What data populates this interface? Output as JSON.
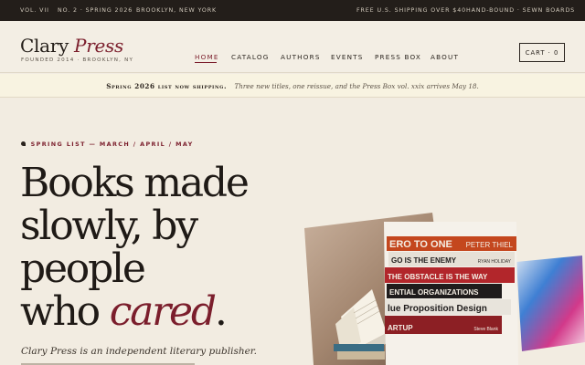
{
  "topbar": {
    "volume": "VOL. VII",
    "issue": "NO. 2 · SPRING 2026",
    "location": "BROOKLYN, NEW YORK",
    "shipping": "FREE U.S. SHIPPING OVER $40",
    "binding": "HAND-BOUND · SEWN BOARDS"
  },
  "brand": {
    "name": "Clary",
    "name_accent": "Press",
    "tagline": "FOUNDED 2014 · BROOKLYN, NY"
  },
  "nav": {
    "items": [
      {
        "label": "HOME",
        "active": true
      },
      {
        "label": "CATALOG"
      },
      {
        "label": "AUTHORS"
      },
      {
        "label": "EVENTS"
      },
      {
        "label": "PRESS BOX"
      },
      {
        "label": "ABOUT"
      }
    ],
    "cart_label": "CART · 0"
  },
  "announcement": {
    "strong": "Spring 2026 list now shipping.",
    "detail": "Three new titles, one reissue, and the Press Box vol. xxix arrives May 18."
  },
  "hero": {
    "eyebrow_icon": "leaf-icon",
    "eyebrow": "SPRING LIST — MARCH / APRIL / MAY",
    "line1": "Books made",
    "line2": "slowly, by",
    "line3": "people",
    "line4_start": "who ",
    "line4_accent": "cared",
    "line4_end": ".",
    "intro": "Clary Press is an independent literary publisher."
  },
  "book_spines": [
    {
      "title": "ERO TO ONE",
      "author": "PETER THIEL",
      "color": "#c4471e"
    },
    {
      "title": "GO IS THE ENEMY",
      "author": "RYAN HOLIDAY",
      "color": "#e6e0d6"
    },
    {
      "title": "THE OBSTACLE IS THE WAY",
      "author": "",
      "color": "#b2262b"
    },
    {
      "title": "ENTIAL ORGANIZATIONS",
      "author": "",
      "color": "#1f1c1c"
    },
    {
      "title": "lue Proposition Design",
      "author": "",
      "color": "#e8e4dc"
    },
    {
      "title": "ARTUP",
      "author": "Steve Blank",
      "color": "#8c1f24"
    }
  ],
  "colors": {
    "accent": "#7b1e2c",
    "topbar_bg": "#231e1a",
    "page_bg": "#f2ece1",
    "banner_bg": "#f8f3e1"
  }
}
